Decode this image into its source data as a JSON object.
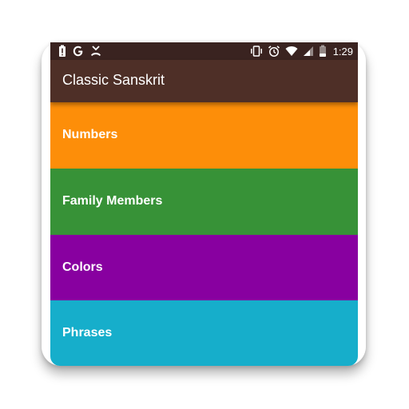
{
  "statusbar": {
    "time": "1:29",
    "left_icons": [
      "battery-alert-icon",
      "google-icon",
      "missed-call-icon"
    ],
    "right_icons": [
      "vibrate-icon",
      "alarm-icon",
      "wifi-icon",
      "signal-icon",
      "battery-icon"
    ]
  },
  "appbar": {
    "title": "Classic Sanskrit"
  },
  "categories": [
    {
      "label": "Numbers",
      "color": "#fd8e09"
    },
    {
      "label": "Family Members",
      "color": "#379237"
    },
    {
      "label": "Colors",
      "color": "#8800a0"
    },
    {
      "label": "Phrases",
      "color": "#16aecb"
    }
  ],
  "colors": {
    "statusbar": "#3a2320",
    "appbar": "#4e2f27"
  }
}
